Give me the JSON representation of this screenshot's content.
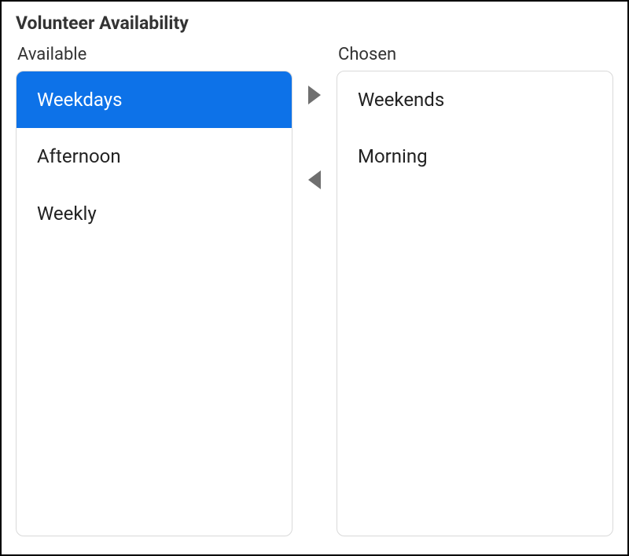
{
  "title": "Volunteer Availability",
  "available": {
    "label": "Available",
    "items": [
      {
        "label": "Weekdays",
        "selected": true
      },
      {
        "label": "Afternoon",
        "selected": false
      },
      {
        "label": "Weekly",
        "selected": false
      }
    ]
  },
  "chosen": {
    "label": "Chosen",
    "items": [
      {
        "label": "Weekends",
        "selected": false
      },
      {
        "label": "Morning",
        "selected": false
      }
    ]
  },
  "colors": {
    "selected_bg": "#0d72e8",
    "arrow_fill": "#6f6f6f"
  }
}
